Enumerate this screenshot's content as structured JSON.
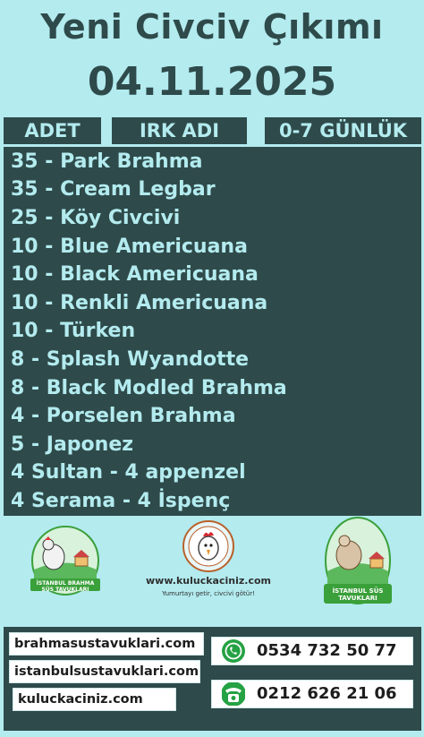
{
  "title": "Yeni Civciv Çıkımı",
  "date": "04.11.2025",
  "headers": {
    "adet": "ADET",
    "irk": "IRK ADI",
    "age": "0-7 GÜNLÜK"
  },
  "items": [
    "35 - Park Brahma",
    "35 - Cream Legbar",
    "25 - Köy Civcivi",
    "10 - Blue Americuana",
    "10 - Black Americuana",
    "10 - Renkli Americuana",
    "10 - Türken",
    "8 - Splash Wyandotte",
    "8 - Black Modled Brahma",
    "4 - Porselen Brahma",
    "5 - Japonez",
    "4 Sultan - 4 appenzel",
    "4 Serama - 4 İspenç"
  ],
  "logos": {
    "left_badge": "İSTANBUL BRAHMA SÜS TAVUKLARI",
    "center_url": "www.kuluckaciniz.com",
    "center_slogan": "Yumurtayı getir, civcivi götür!",
    "right_badge": "İSTANBUL SÜS TAVUKLARI"
  },
  "websites": [
    "brahmasustavuklari.com",
    "istanbulsustavuklari.com",
    "kuluckaciniz.com"
  ],
  "phones": {
    "mobile": "0534 732 50 77",
    "landline": "0212 626 21 06"
  },
  "colors": {
    "background": "#b3ebef",
    "dark": "#2f4a4a",
    "whatsapp": "#25a244"
  },
  "icons": {
    "mobile": "whatsapp-icon",
    "landline": "telephone-icon"
  }
}
